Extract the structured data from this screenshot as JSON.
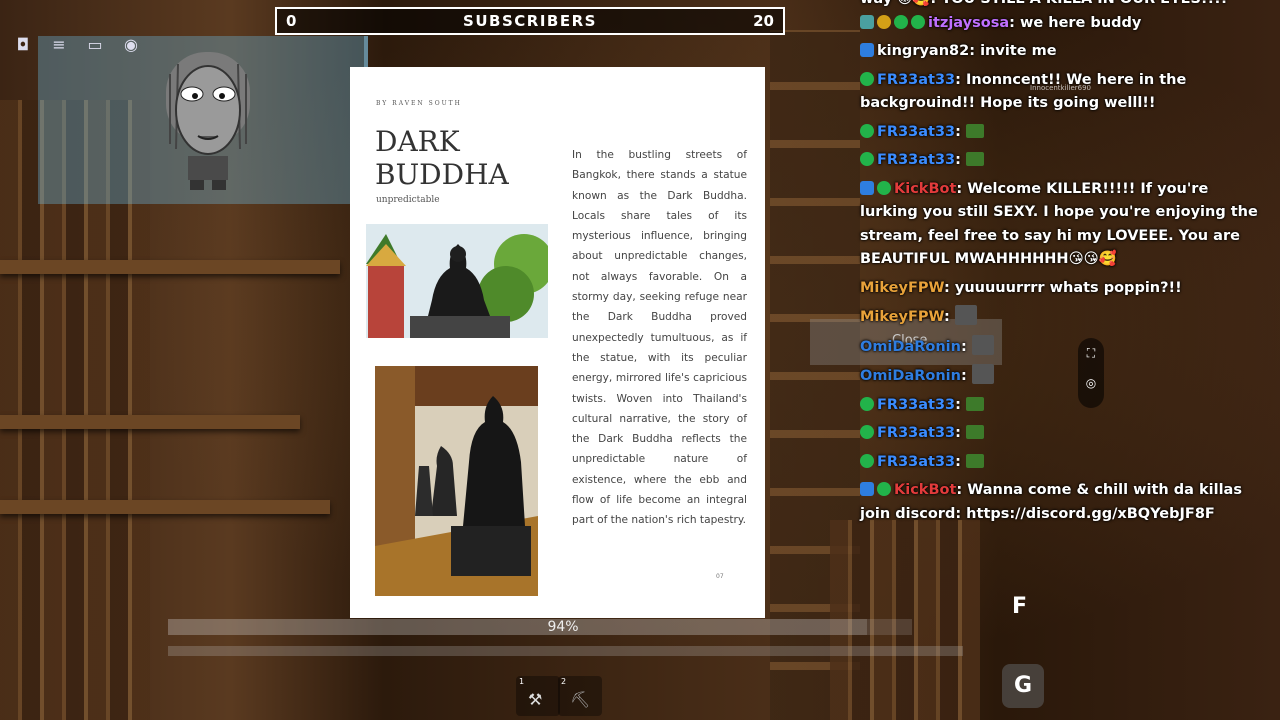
{
  "subscriber_goal": {
    "current": "0",
    "label": "SUBSCRIBERS",
    "target": "20"
  },
  "book_page": {
    "byline": "BY RAVEN SOUTH",
    "title_line1": "DARK",
    "title_line2": "BUDDHA",
    "subtitle": "unpredictable",
    "body": "In the bustling streets of Bangkok, there stands a statue known as the Dark Buddha. Locals share tales of its mysterious influence, bringing about unpredictable changes, not always favorable. On a stormy day, seeking refuge near the Dark Buddha proved unexpectedly tumultuous, as if the statue, with its peculiar energy, mirrored life's capricious twists. Woven into Thailand's cultural narrative, the story of the Dark Buddha reflects the unpredictable nature of existence, where the ebb and flow of life become an integral part of the nation's rich tapestry.",
    "page_number": "07"
  },
  "progress": {
    "label": "94%",
    "value": 0.94
  },
  "hotbar": [
    {
      "slot": "1"
    },
    {
      "slot": "2"
    }
  ],
  "keys": {
    "f": "F",
    "g": "G"
  },
  "close_label": "Close",
  "ghost_name": "Innocentkiller690",
  "colors": {
    "kickbot": "#e23b3b",
    "mikey": "#e8a23a",
    "omi": "#2f7de0",
    "fr": "#3b8cff",
    "itzjay": "#c070ff",
    "king": "#ffffff"
  },
  "chat": [
    {
      "user": "itzjaysosa",
      "text": "we here buddy"
    },
    {
      "user": "kingryan82",
      "text": "invite me"
    },
    {
      "user": "FR33at33",
      "text": "Inonncent!! We here in the backgrouind!! Hope its going welll!!"
    },
    {
      "user": "FR33at33",
      "text": ""
    },
    {
      "user": "FR33at33",
      "text": ""
    },
    {
      "user": "KickBot",
      "text": "Welcome KILLER!!!!! If you're lurking you still SEXY. I hope you're enjoying the stream, feel free to say hi my LOVEEE. You are BEAUTIFUL MWAHHHHHH😘😘🥰"
    },
    {
      "user": "MikeyFPW",
      "text": "yuuuuurrrr whats poppin?!!"
    },
    {
      "user": "MikeyFPW",
      "text": ""
    },
    {
      "user": "OmiDaRonin",
      "text": ""
    },
    {
      "user": "OmiDaRonin",
      "text": ""
    },
    {
      "user": "FR33at33",
      "text": ""
    },
    {
      "user": "FR33at33",
      "text": ""
    },
    {
      "user": "FR33at33",
      "text": ""
    },
    {
      "user": "KickBot",
      "text": "Wanna come & chill with da killas join discord: https://discord.gg/xBQYebJF8F"
    }
  ],
  "chat_top_partial": "way 😡🥰: YOU STILL A KILLA IN OUR EYES!!!!"
}
